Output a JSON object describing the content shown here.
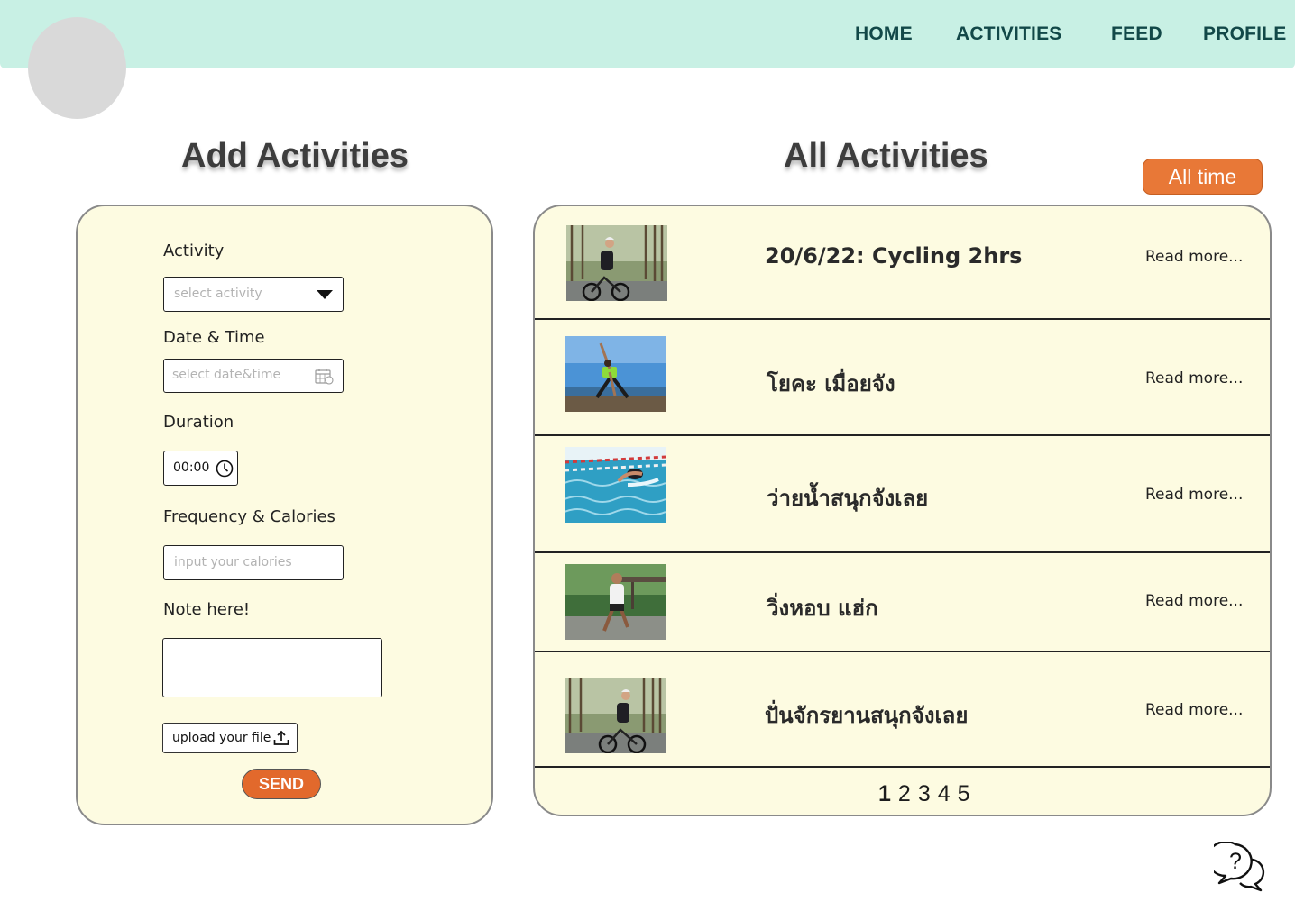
{
  "nav": {
    "items": [
      {
        "label": "HOME"
      },
      {
        "label": "ACTIVITIES"
      },
      {
        "label": "FEED"
      },
      {
        "label": "PROFILE"
      }
    ]
  },
  "add": {
    "title": "Add Activities",
    "activity_label": "Activity",
    "activity_placeholder": "select activity",
    "datetime_label": "Date  & Time",
    "datetime_placeholder": "select  date&time",
    "duration_label": "Duration",
    "duration_value": "00:00",
    "calories_label": "Frequency & Calories",
    "calories_placeholder": "input your calories",
    "note_label": "Note here!",
    "upload_label": "upload your file",
    "send_label": "SEND"
  },
  "all": {
    "title": "All Activities",
    "filter_label": "All time",
    "read_more": "Read more...",
    "items": [
      {
        "title": "20/6/22: Cycling  2hrs",
        "image": "cycling-photo"
      },
      {
        "title": "โยคะ เมื่อยจัง",
        "image": "yoga-photo"
      },
      {
        "title": "ว่ายน้ำสนุกจังเลย",
        "image": "swimming-photo"
      },
      {
        "title": "วิ่งหอบ  แฮ่ก",
        "image": "running-photo"
      },
      {
        "title": "ปั่นจักรยานสนุกจังเลย",
        "image": "cycling-photo"
      }
    ],
    "pages": [
      "1",
      "2",
      "3",
      "4",
      "5"
    ],
    "current_page": "1"
  },
  "icons": [
    "dropdown-arrow-icon",
    "calendar-icon",
    "clock-icon",
    "upload-icon",
    "chat-help-icon"
  ],
  "colors": {
    "topbar": "#c8f0e4",
    "accent": "#e87837",
    "panel": "#fdfbe1",
    "nav_text": "#124848"
  }
}
